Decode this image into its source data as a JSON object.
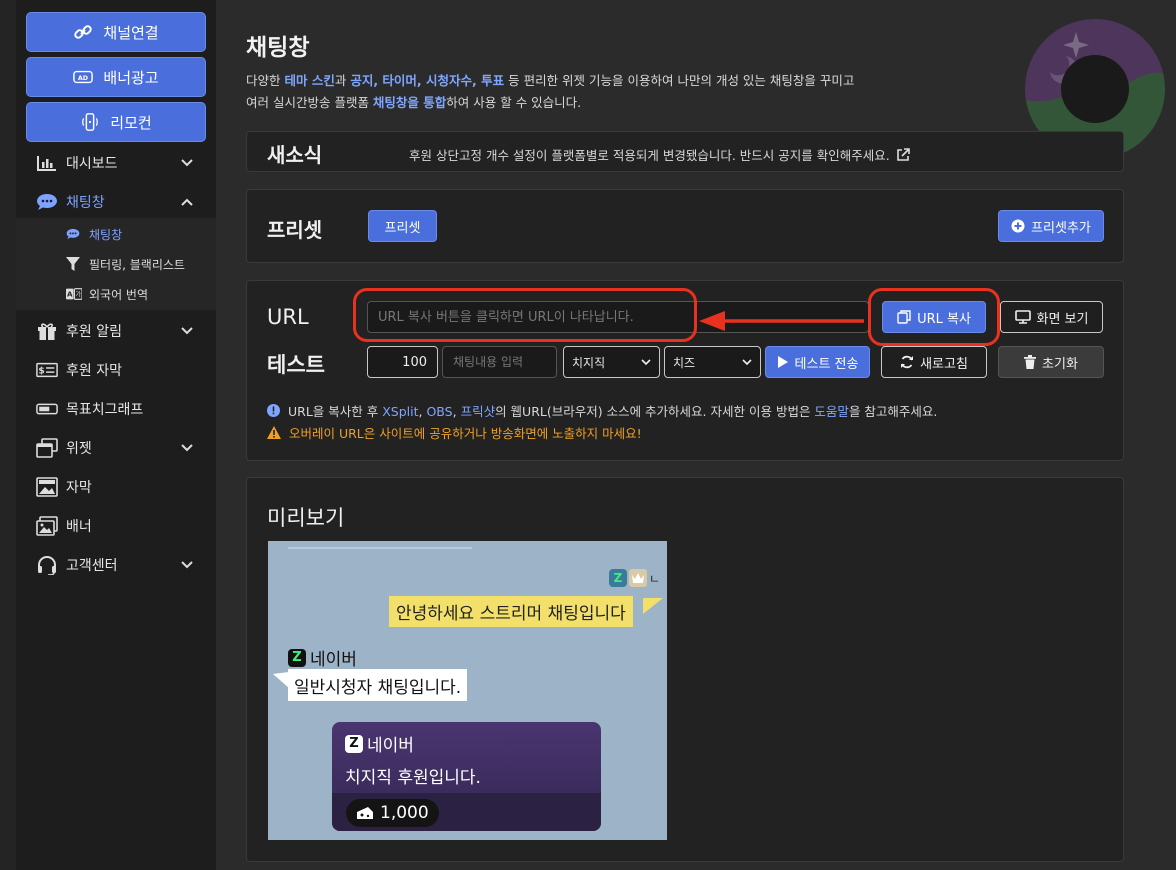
{
  "sidebar": {
    "top_buttons": [
      {
        "label": "채널연결",
        "icon": "link-icon"
      },
      {
        "label": "배너광고",
        "icon": "ad-icon"
      },
      {
        "label": "리모컨",
        "icon": "remote-icon"
      }
    ],
    "items": [
      {
        "label": "대시보드",
        "icon": "bar-chart-icon",
        "chevron": "down"
      },
      {
        "label": "채팅창",
        "icon": "chat-bubble-icon",
        "chevron": "up",
        "active": true
      },
      {
        "label": "후원 알림",
        "icon": "gift-icon",
        "chevron": "down"
      },
      {
        "label": "후원 자막",
        "icon": "money-icon"
      },
      {
        "label": "목표치그래프",
        "icon": "progress-bar-icon"
      },
      {
        "label": "위젯",
        "icon": "windows-icon",
        "chevron": "down"
      },
      {
        "label": "자막",
        "icon": "image-caption-icon"
      },
      {
        "label": "배너",
        "icon": "image-icon"
      },
      {
        "label": "고객센터",
        "icon": "headset-icon",
        "chevron": "down"
      }
    ],
    "subitems": [
      {
        "label": "채팅창",
        "icon": "chat-bubble-icon",
        "active": true
      },
      {
        "label": "필터링, 블랙리스트",
        "icon": "filter-icon"
      },
      {
        "label": "외국어 번역",
        "icon": "translate-icon"
      }
    ]
  },
  "page": {
    "title": "채팅창",
    "desc1_pre": "다양한 ",
    "desc1_b1": "테마 스킨",
    "desc1_mid": "과 ",
    "desc1_b2": "공지, 타이머, 시청자수, 투표",
    "desc1_post": " 등 편리한 위젯 기능을 이용하여 나만의 개성 있는 채팅창을 꾸미고",
    "desc2_pre": "여러 실시간방송 플랫폼 ",
    "desc2_b": "채팅창을 통합",
    "desc2_post": "하여 사용 할 수 있습니다."
  },
  "news": {
    "title": "새소식",
    "text": "후원 상단고정 개수 설정이 플랫폼별로 적용되게 변경됐습니다. 반드시 공지를 확인해주세요."
  },
  "preset": {
    "title": "프리셋",
    "preset_button": "프리셋",
    "add_button": "프리셋추가"
  },
  "url_section": {
    "url_label": "URL",
    "url_placeholder": "URL 복사 버튼을 클릭하면 URL이 나타납니다.",
    "copy_button": "URL 복사",
    "view_button": "화면 보기",
    "test_label": "테스트",
    "test_amount": "100",
    "test_placeholder": "채팅내용 입력",
    "select1": "치지직",
    "select2": "치즈",
    "send_button": "테스트 전송",
    "refresh_button": "새로고침",
    "reset_button": "초기화",
    "note1_pre": "URL을 복사한 후 ",
    "note1_l1": "XSplit",
    "note1_c1": ", ",
    "note1_l2": "OBS",
    "note1_c2": ", ",
    "note1_l3": "프릭샷",
    "note1_mid": "의 웹URL(브라우저) 소스에 추가하세요. 자세한 이용 방법은 ",
    "note1_l4": "도움말",
    "note1_post": "을 참고해주세요.",
    "note2": "오버레이 URL은 사이트에 공유하거나 방송화면에 노출하지 마세요!"
  },
  "preview": {
    "title": "미리보기",
    "truncated_name": "ㄴ",
    "streamer_msg": "안녕하세요 스트리머 채팅입니다",
    "viewer_name": "네이버",
    "viewer_msg": "일반시청자 채팅입니다.",
    "donor_name": "네이버",
    "donor_msg": "치지직 후원입니다.",
    "donation_amount": "1,000"
  },
  "colors": {
    "accent": "#4a6fdc",
    "link": "#7fa6ff",
    "warning": "#f0a020",
    "highlight": "#e8321f",
    "chat_streamer_bg": "#f3e06a",
    "preview_bg": "#9db3c7"
  }
}
